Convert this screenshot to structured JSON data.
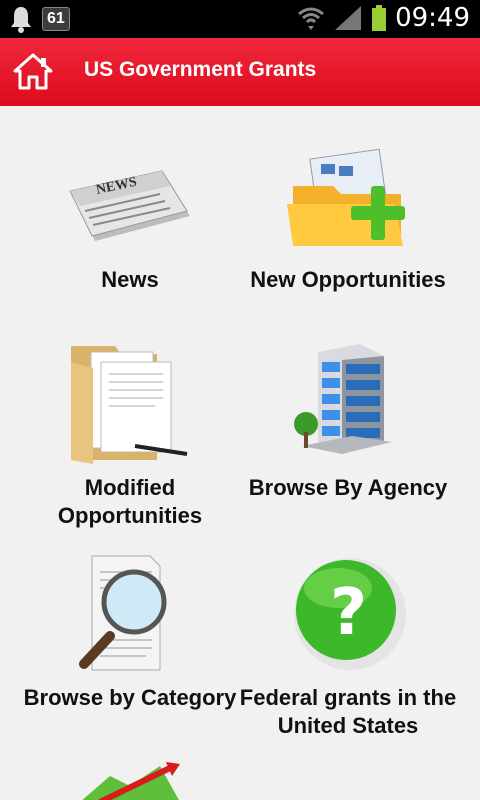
{
  "status_bar": {
    "notification_count": "61",
    "time": "09:49"
  },
  "action_bar": {
    "title": "US Government Grants",
    "home_icon": "home-icon"
  },
  "menu": {
    "items": [
      {
        "label": "News",
        "icon": "newspaper-icon"
      },
      {
        "label": "New Opportunities",
        "icon": "folder-add-icon"
      },
      {
        "label": "Modified Opportunities",
        "icon": "documents-folder-icon"
      },
      {
        "label": "Browse By Agency",
        "icon": "office-building-icon"
      },
      {
        "label": "Browse by Category",
        "icon": "document-magnifier-icon"
      },
      {
        "label": "Federal grants in the United States",
        "icon": "question-icon"
      },
      {
        "label": "",
        "icon": "chart-icon"
      }
    ]
  },
  "colors": {
    "action_bar": "#e8172b",
    "background": "#f1f1f1",
    "status_bar": "#000000"
  }
}
